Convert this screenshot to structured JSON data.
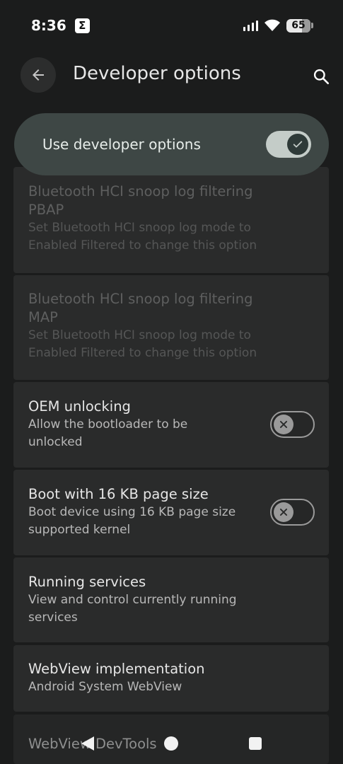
{
  "status_bar": {
    "time": "8:36",
    "notification_badge": "Σ",
    "battery_level": "65",
    "icons": [
      "signal-icon",
      "wifi-icon",
      "battery-icon"
    ]
  },
  "header": {
    "title": "Developer options",
    "back_icon": "arrow-back-icon",
    "search_icon": "search-icon"
  },
  "master_switch": {
    "label": "Use developer options",
    "checked": true,
    "accent_color": "#3e4745"
  },
  "settings": [
    {
      "title": "Bluetooth HCI snoop log filtering PBAP",
      "title_lines": [
        "Bluetooth HCI snoop log filtering",
        "PBAP"
      ],
      "subtitle_lines": [
        "Set Bluetooth HCI snoop log mode to",
        "Enabled Filtered to change this option"
      ],
      "enabled": false
    },
    {
      "title": "Bluetooth HCI snoop log filtering MAP",
      "title_lines": [
        "Bluetooth HCI snoop log filtering",
        "MAP"
      ],
      "subtitle_lines": [
        "Set Bluetooth HCI snoop log mode to",
        "Enabled Filtered to change this option"
      ],
      "enabled": false
    },
    {
      "title_lines": [
        "OEM unlocking"
      ],
      "subtitle_lines": [
        "Allow the bootloader to be",
        "unlocked"
      ],
      "enabled": true,
      "toggle": false
    },
    {
      "title_lines": [
        "Boot with 16 KB page size"
      ],
      "subtitle_lines": [
        "Boot device using 16 KB page size",
        "supported kernel"
      ],
      "enabled": true,
      "toggle": false
    },
    {
      "title_lines": [
        "Running services"
      ],
      "subtitle_lines": [
        "View and control currently running",
        "services"
      ],
      "enabled": true
    },
    {
      "title_lines": [
        "WebView implementation"
      ],
      "subtitle_lines": [
        "Android System WebView"
      ],
      "enabled": true
    },
    {
      "title_lines": [
        "WebView DevTools"
      ],
      "subtitle_lines": [],
      "enabled": true
    }
  ],
  "nav_bar": {
    "icons": [
      "nav-back-icon",
      "nav-home-icon",
      "nav-recents-icon"
    ]
  }
}
